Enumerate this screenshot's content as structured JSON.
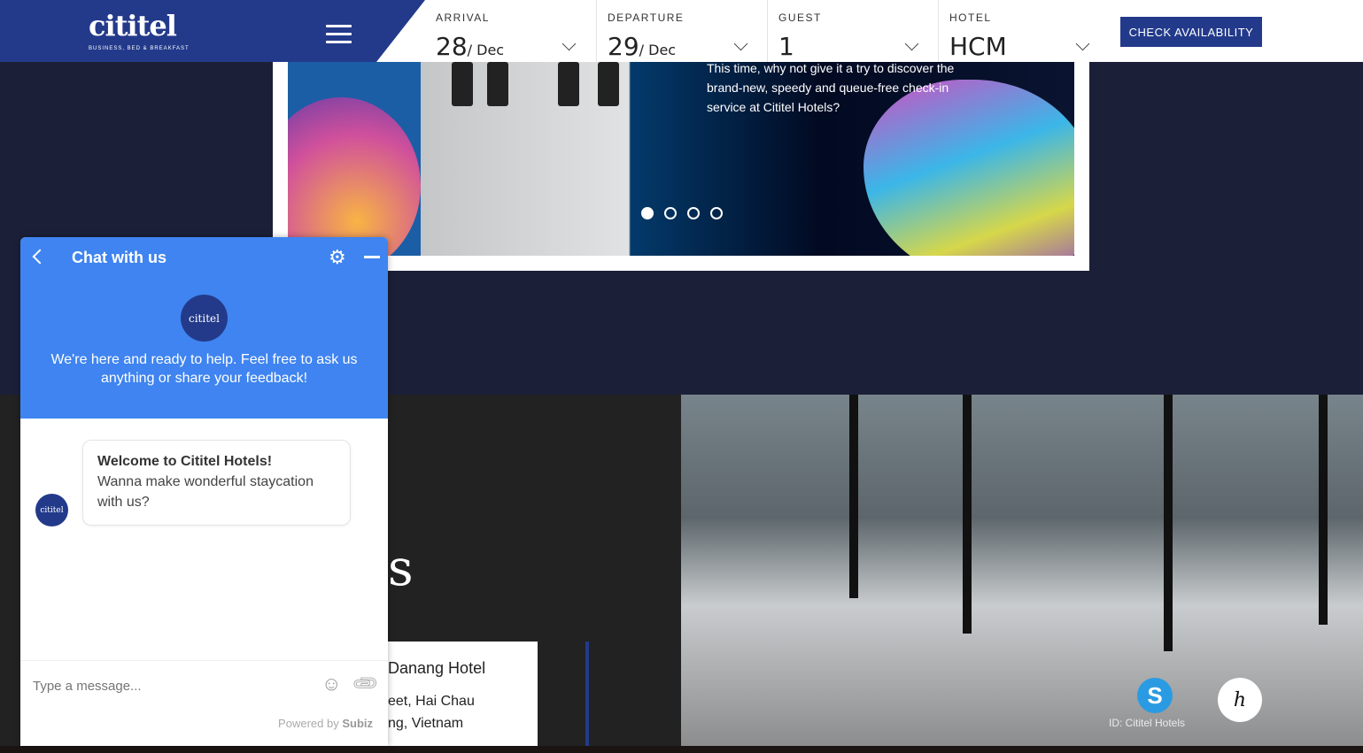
{
  "header": {
    "logo": "cititel",
    "tagline": "BUSINESS, BED & BREAKFAST",
    "fields": [
      {
        "label": "ARRIVAL",
        "value": "28",
        "suffix": "/ Dec"
      },
      {
        "label": "DEPARTURE",
        "value": "29",
        "suffix": "/ Dec"
      },
      {
        "label": "GUEST",
        "value": "1",
        "suffix": ""
      },
      {
        "label": "HOTEL",
        "value": "HCM",
        "suffix": ""
      }
    ],
    "check_label": "CHECK AVAILABILITY"
  },
  "slider": {
    "text": "This time, why not give it a try to discover the brand-new, speedy and queue-free check-in service at Cititel Hotels?",
    "active_index": 0,
    "count": 4
  },
  "section": {
    "title_fragment": "ls",
    "hotel_name": "Danang Hotel",
    "address_line1": "eet, Hai Chau",
    "address_line2": "ng, Vietnam"
  },
  "social": {
    "skype_id": "ID: Cititel Hotels",
    "skype_glyph": "S",
    "sig_glyph": "h"
  },
  "chat": {
    "title": "Chat with us",
    "avatar_text": "cititel",
    "intro": "We're here and ready to help. Feel free to ask us anything or share your feedback!",
    "welcome_title": "Welcome to Cititel Hotels!",
    "welcome_body": "Wanna make wonderful staycation with us?",
    "placeholder": "Type a message...",
    "powered_prefix": "Powered by",
    "powered_brand": "Subiz"
  },
  "colors": {
    "brand": "#233a8b",
    "chat": "#3f84f0",
    "navy_bg": "#1b2038"
  }
}
